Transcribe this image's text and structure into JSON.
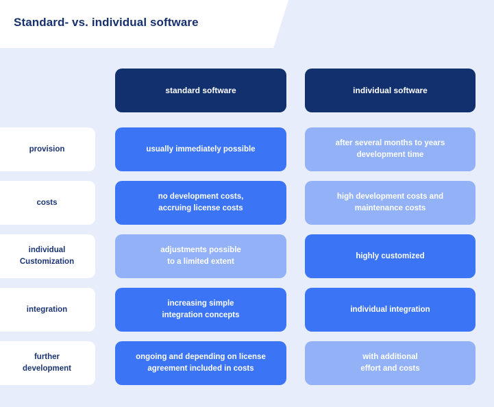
{
  "header": {
    "title": "Standard- vs. individual software"
  },
  "colors": {
    "background": "#e8edfb",
    "header_bg": "#ffffff",
    "title_text": "#16306e",
    "dark_card": "#12306e",
    "strong_blue_card": "#3b74f5",
    "light_blue_card": "#92b1f7",
    "label_card": "#ffffff",
    "label_text": "#1b3473",
    "card_text": "#ffffff"
  },
  "table": {
    "corner_label": "",
    "columns": [
      {
        "label": "standard software"
      },
      {
        "label": "individual software"
      }
    ],
    "rows": [
      {
        "label": "provision",
        "cells": [
          {
            "text": "usually immediately possible",
            "tone": "strong"
          },
          {
            "text": "after several months to years\ndevelopment time",
            "tone": "light"
          }
        ]
      },
      {
        "label": "costs",
        "cells": [
          {
            "text": "no development costs,\naccruing license costs",
            "tone": "strong"
          },
          {
            "text": "high development costs and\nmaintenance costs",
            "tone": "light"
          }
        ]
      },
      {
        "label": "individual\nCustomization",
        "cells": [
          {
            "text": "adjustments possible\nto a limited extent",
            "tone": "light"
          },
          {
            "text": "highly customized",
            "tone": "strong"
          }
        ]
      },
      {
        "label": "integration",
        "cells": [
          {
            "text": "increasing simple\nintegration concepts",
            "tone": "strong"
          },
          {
            "text": "individual integration",
            "tone": "strong"
          }
        ]
      },
      {
        "label": "further\ndevelopment",
        "cells": [
          {
            "text": "ongoing and depending on license\nagreement included in costs",
            "tone": "strong"
          },
          {
            "text": "with additional\neffort and costs",
            "tone": "light"
          }
        ]
      }
    ]
  }
}
